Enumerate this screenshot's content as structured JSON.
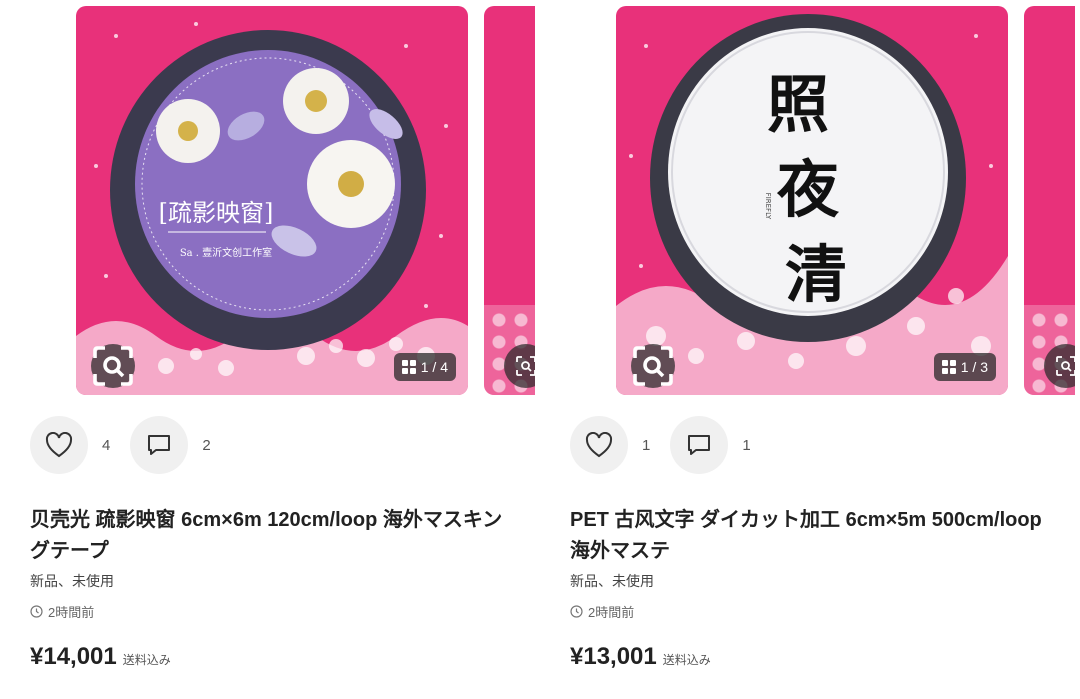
{
  "items": [
    {
      "image_counter": "1 / 4",
      "tape_label": "[疏影映窗]",
      "tape_signature": "Sa . 壹沂文创工作室",
      "likes": "4",
      "comments": "2",
      "title": "贝壳光 疏影映窗 6cm×6m 120cm/loop 海外マスキングテープ",
      "condition": "新品、未使用",
      "posted": "2時間前",
      "price": "¥14,001",
      "shipping": "送料込み"
    },
    {
      "image_counter": "1 / 3",
      "tape_label": "照夜清",
      "tape_signature": "FIREFLY",
      "likes": "1",
      "comments": "1",
      "title": "PET 古风文字 ダイカット加工 6cm×5m 500cm/loop 海外マステ",
      "condition": "新品、未使用",
      "posted": "2時間前",
      "price": "¥13,001",
      "shipping": "送料込み"
    }
  ],
  "icons": {
    "lens": "image-search-icon",
    "grid": "gallery-grid-icon",
    "like": "heart-icon",
    "comment": "comment-icon",
    "clock": "clock-icon"
  },
  "colors": {
    "background_pink": "#e8317a",
    "tape_purple": "#8b6fc2",
    "tape_white": "#f4f4f6"
  }
}
